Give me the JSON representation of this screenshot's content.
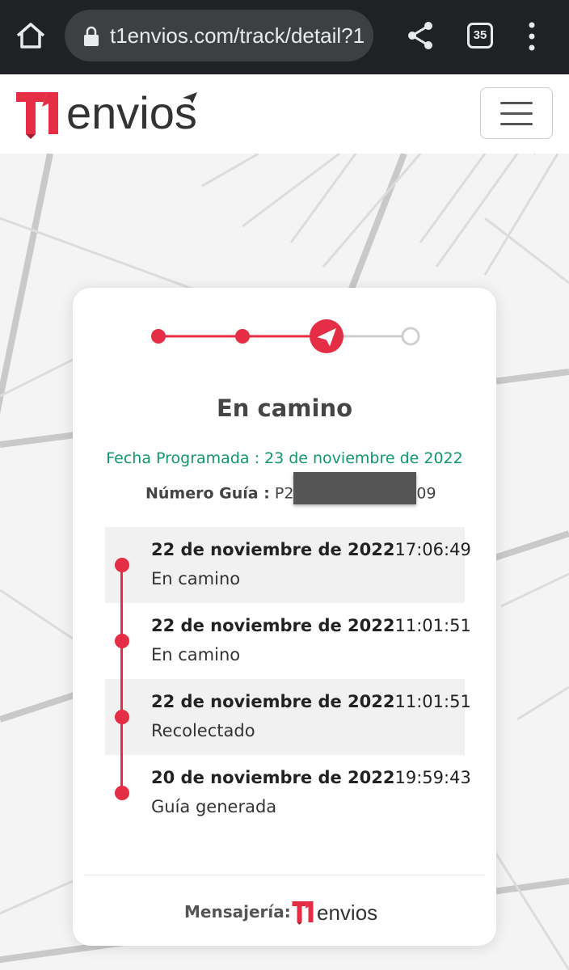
{
  "browser": {
    "url": "t1envios.com/track/detail?1",
    "tab_count": "35"
  },
  "header": {
    "logo_text": "envios",
    "logo_mark": "T1"
  },
  "tracking": {
    "progress_step": 3,
    "total_steps": 4,
    "status_title": "En camino",
    "fecha_programada": "Fecha Programada : 23 de noviembre de 2022",
    "guia_label": "Número Guía :",
    "guia_prefix": "P2",
    "guia_suffix": "09",
    "events": [
      {
        "date": "22 de noviembre de 2022",
        "time": "17:06:49",
        "description": "En camino"
      },
      {
        "date": "22 de noviembre de 2022",
        "time": "11:01:51",
        "description": "En camino"
      },
      {
        "date": "22 de noviembre de 2022",
        "time": "11:01:51",
        "description": "Recolectado"
      },
      {
        "date": "20 de noviembre de 2022",
        "time": "19:59:43",
        "description": "Guía generada"
      }
    ]
  },
  "footer": {
    "label": "Mensajería:",
    "logo_mark": "T1",
    "logo_text": "envios"
  },
  "colors": {
    "brand_red": "#e52e45",
    "green": "#13966b",
    "chrome_bg": "#202124"
  }
}
